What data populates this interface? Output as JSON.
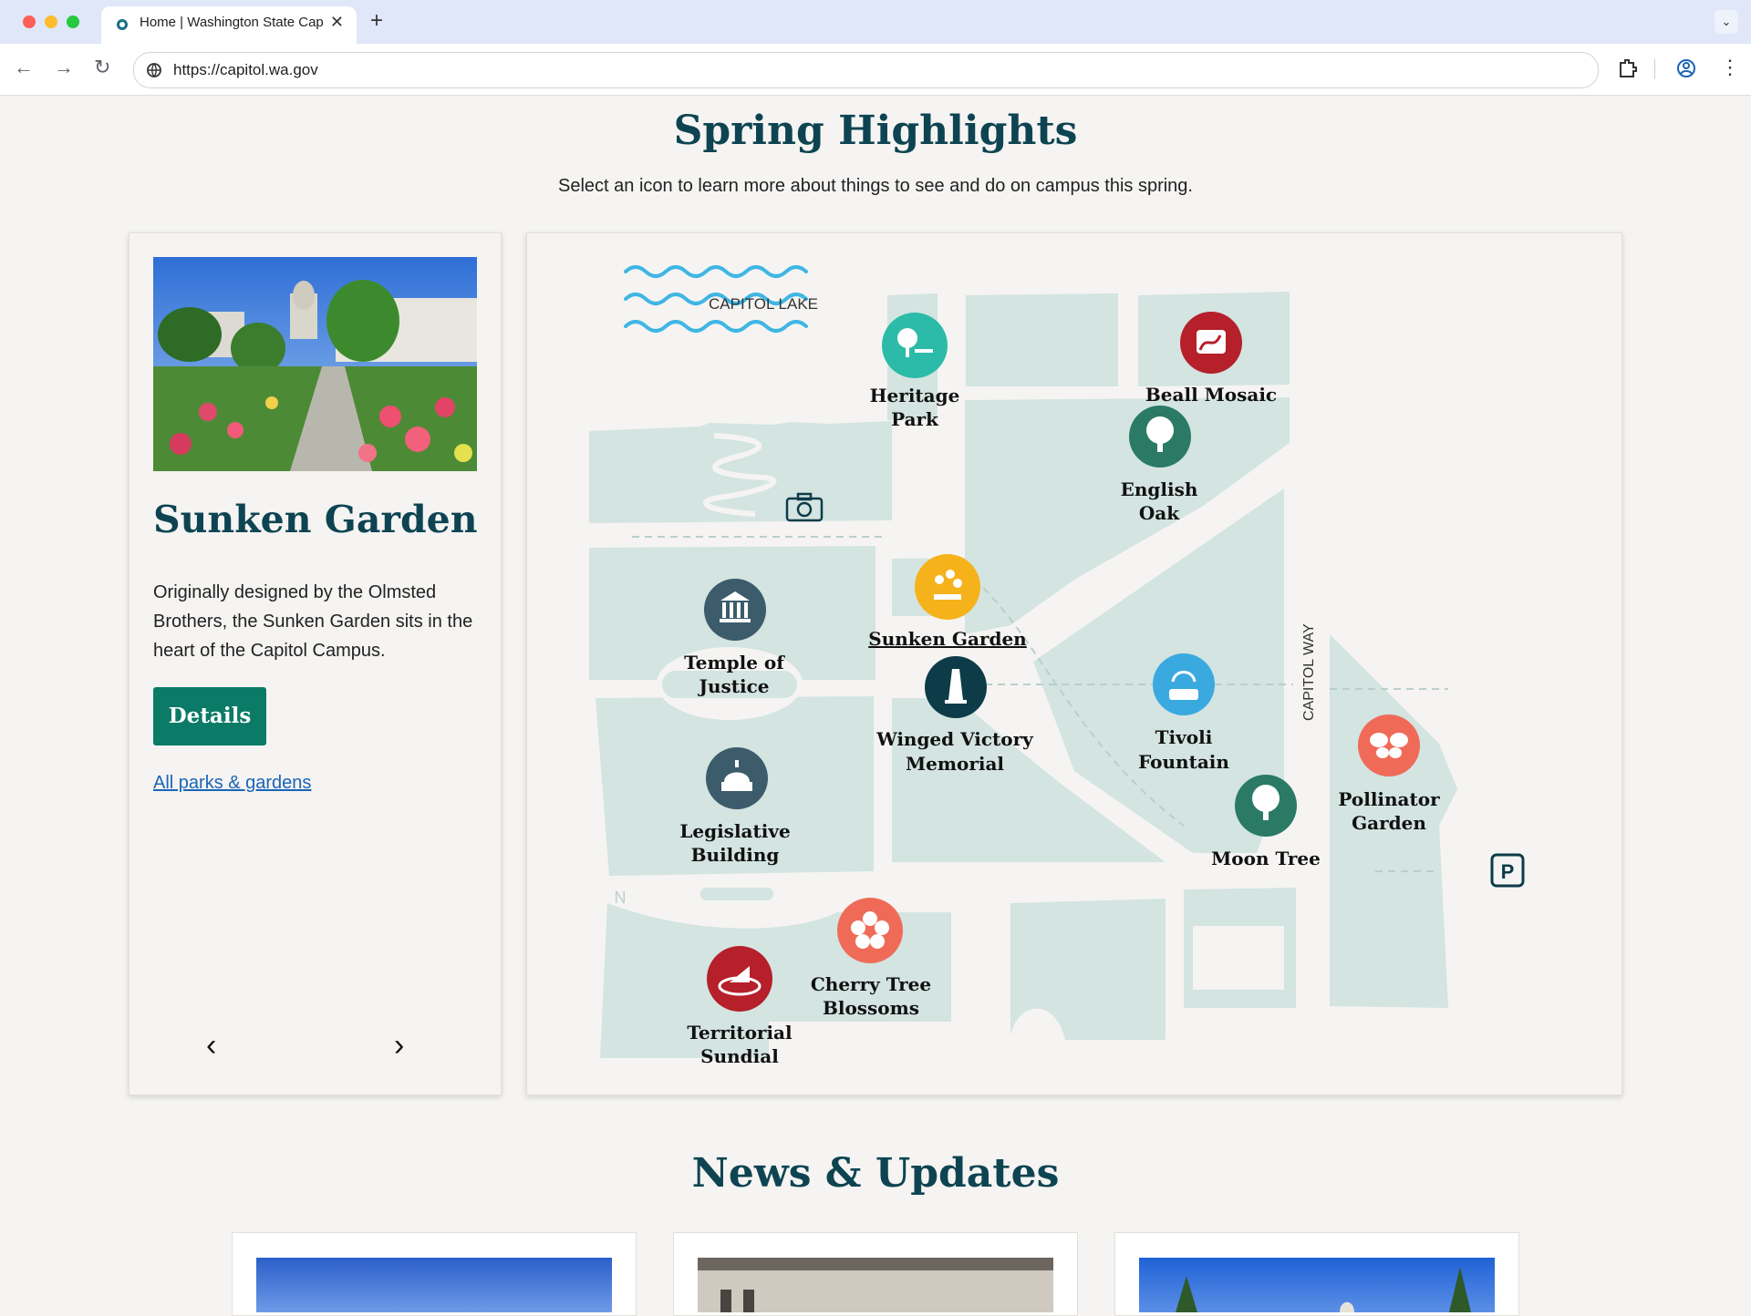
{
  "browser": {
    "tab_title": "Home | Washington State Cap",
    "new_tab": "+",
    "tab_close": "✕",
    "tab_menu": "⌄",
    "url": "https://capitol.wa.gov",
    "back": "←",
    "forward": "→",
    "reload": "↻",
    "menu": "⋮"
  },
  "highlights": {
    "heading": "Spring Highlights",
    "subheading": "Select an icon to learn more about things to see and do on campus this spring."
  },
  "card": {
    "title": "Sunken Garden",
    "description": "Originally designed by the Olmsted Brothers, the Sunken Garden sits in the heart of the Capitol Campus.",
    "details_label": "Details",
    "all_link": "All parks & gardens",
    "prev": "‹",
    "next": "›"
  },
  "map": {
    "lake_label": "CAPITOL LAKE",
    "road_label": "CAPITOL WAY",
    "north_label": "N",
    "parking_label": "P",
    "markers": {
      "heritage_park": [
        "Heritage",
        "Park"
      ],
      "beall_mosaic": [
        "Beall Mosaic"
      ],
      "english_oak": [
        "English",
        "Oak"
      ],
      "temple_of_justice": [
        "Temple of",
        "Justice"
      ],
      "sunken_garden": [
        "Sunken Garden"
      ],
      "winged_victory": [
        "Winged Victory",
        "Memorial"
      ],
      "tivoli_fountain": [
        "Tivoli",
        "Fountain"
      ],
      "pollinator_garden": [
        "Pollinator",
        "Garden"
      ],
      "moon_tree": [
        "Moon Tree"
      ],
      "legislative_building": [
        "Legislative",
        "Building"
      ],
      "cherry_tree": [
        "Cherry Tree",
        "Blossoms"
      ],
      "territorial_sundial": [
        "Territorial",
        "Sundial"
      ]
    }
  },
  "news": {
    "heading": "News & Updates"
  },
  "colors": {
    "heading": "#0e4452",
    "button": "#0b7a66",
    "link": "#1a64b8",
    "map_land": "#d3e4e1",
    "teal_marker": "#2bbba8",
    "red_marker": "#b5202a",
    "green_marker": "#2a7a66",
    "slate_marker": "#3c5b6b",
    "yellow_marker": "#f6b21b",
    "navy_marker": "#0d3b48",
    "blue_marker": "#3aa9e0",
    "coral_marker": "#ef6b58"
  }
}
